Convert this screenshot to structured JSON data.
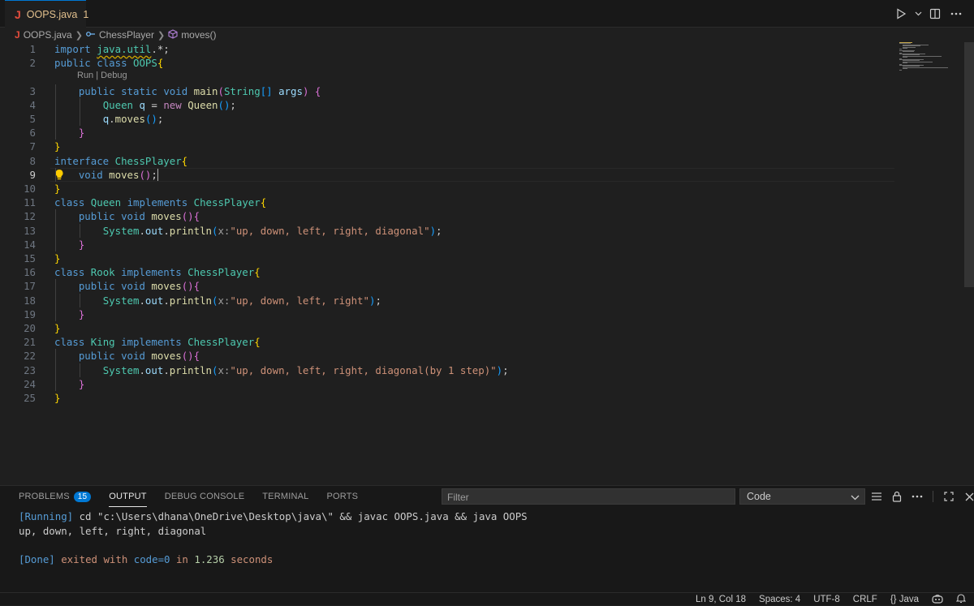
{
  "tab": {
    "icon": "java-icon",
    "name": "OOPS.java",
    "problems": "1",
    "close": "×"
  },
  "breadcrumb": {
    "file": "OOPS.java",
    "symbol1": "ChessPlayer",
    "symbol2": "moves()"
  },
  "editor": {
    "codelens": "Run | Debug",
    "line_numbers": [
      "1",
      "2",
      "3",
      "4",
      "5",
      "6",
      "7",
      "8",
      "9",
      "10",
      "11",
      "12",
      "13",
      "14",
      "15",
      "16",
      "17",
      "18",
      "19",
      "20",
      "21",
      "22",
      "23",
      "24",
      "25"
    ],
    "active_line": "9",
    "lines": [
      [
        [
          "kw",
          "import"
        ],
        [
          "pl",
          " "
        ],
        [
          "ty squig",
          "java.util"
        ],
        [
          "pl",
          ".*;"
        ]
      ],
      [
        [
          "kw",
          "public"
        ],
        [
          "pl",
          " "
        ],
        [
          "kw",
          "class"
        ],
        [
          "pl",
          " "
        ],
        [
          "ty",
          "OOPS"
        ],
        [
          "b1",
          "{"
        ]
      ],
      [
        [
          "pl",
          "    "
        ],
        [
          "kw",
          "public"
        ],
        [
          "pl",
          " "
        ],
        [
          "kw",
          "static"
        ],
        [
          "pl",
          " "
        ],
        [
          "kw",
          "void"
        ],
        [
          "pl",
          " "
        ],
        [
          "fn",
          "main"
        ],
        [
          "b2",
          "("
        ],
        [
          "ty",
          "String"
        ],
        [
          "b3",
          "[]"
        ],
        [
          "pl",
          " "
        ],
        [
          "va",
          "args"
        ],
        [
          "b2",
          ")"
        ],
        [
          "pl",
          " "
        ],
        [
          "b2",
          "{"
        ]
      ],
      [
        [
          "pl",
          "        "
        ],
        [
          "ty",
          "Queen"
        ],
        [
          "pl",
          " "
        ],
        [
          "va",
          "q"
        ],
        [
          "pl",
          " = "
        ],
        [
          "kw2",
          "new"
        ],
        [
          "pl",
          " "
        ],
        [
          "fn",
          "Queen"
        ],
        [
          "b3",
          "()"
        ],
        [
          "pl",
          ";"
        ]
      ],
      [
        [
          "pl",
          "        "
        ],
        [
          "va",
          "q"
        ],
        [
          "pl",
          "."
        ],
        [
          "fn",
          "moves"
        ],
        [
          "b3",
          "()"
        ],
        [
          "pl",
          ";"
        ]
      ],
      [
        [
          "pl",
          "    "
        ],
        [
          "b2",
          "}"
        ]
      ],
      [
        [
          "b1",
          "}"
        ]
      ],
      [
        [
          "kw",
          "interface"
        ],
        [
          "pl",
          " "
        ],
        [
          "ty",
          "ChessPlayer"
        ],
        [
          "b1",
          "{"
        ]
      ],
      [
        [
          "pl",
          "    "
        ],
        [
          "kw",
          "void"
        ],
        [
          "pl",
          " "
        ],
        [
          "fn",
          "moves"
        ],
        [
          "b2",
          "()"
        ],
        [
          "pl",
          ";"
        ]
      ],
      [
        [
          "b1",
          "}"
        ]
      ],
      [
        [
          "kw",
          "class"
        ],
        [
          "pl",
          " "
        ],
        [
          "ty",
          "Queen"
        ],
        [
          "pl",
          " "
        ],
        [
          "kw",
          "implements"
        ],
        [
          "pl",
          " "
        ],
        [
          "ty",
          "ChessPlayer"
        ],
        [
          "b1",
          "{"
        ]
      ],
      [
        [
          "pl",
          "    "
        ],
        [
          "kw",
          "public"
        ],
        [
          "pl",
          " "
        ],
        [
          "kw",
          "void"
        ],
        [
          "pl",
          " "
        ],
        [
          "fn",
          "moves"
        ],
        [
          "b2",
          "()"
        ],
        [
          "b2",
          "{"
        ]
      ],
      [
        [
          "pl",
          "        "
        ],
        [
          "ty",
          "System"
        ],
        [
          "pl",
          "."
        ],
        [
          "va",
          "out"
        ],
        [
          "pl",
          "."
        ],
        [
          "fn",
          "println"
        ],
        [
          "b3",
          "("
        ],
        [
          "pm",
          "x:"
        ],
        [
          "st",
          "\"up, down, left, right, diagonal\""
        ],
        [
          "b3",
          ")"
        ],
        [
          "pl",
          ";"
        ]
      ],
      [
        [
          "pl",
          "    "
        ],
        [
          "b2",
          "}"
        ]
      ],
      [
        [
          "b1",
          "}"
        ]
      ],
      [
        [
          "kw",
          "class"
        ],
        [
          "pl",
          " "
        ],
        [
          "ty",
          "Rook"
        ],
        [
          "pl",
          " "
        ],
        [
          "kw",
          "implements"
        ],
        [
          "pl",
          " "
        ],
        [
          "ty",
          "ChessPlayer"
        ],
        [
          "b1",
          "{"
        ]
      ],
      [
        [
          "pl",
          "    "
        ],
        [
          "kw",
          "public"
        ],
        [
          "pl",
          " "
        ],
        [
          "kw",
          "void"
        ],
        [
          "pl",
          " "
        ],
        [
          "fn",
          "moves"
        ],
        [
          "b2",
          "()"
        ],
        [
          "b2",
          "{"
        ]
      ],
      [
        [
          "pl",
          "        "
        ],
        [
          "ty",
          "System"
        ],
        [
          "pl",
          "."
        ],
        [
          "va",
          "out"
        ],
        [
          "pl",
          "."
        ],
        [
          "fn",
          "println"
        ],
        [
          "b3",
          "("
        ],
        [
          "pm",
          "x:"
        ],
        [
          "st",
          "\"up, down, left, right\""
        ],
        [
          "b3",
          ")"
        ],
        [
          "pl",
          ";"
        ]
      ],
      [
        [
          "pl",
          "    "
        ],
        [
          "b2",
          "}"
        ]
      ],
      [
        [
          "b1",
          "}"
        ]
      ],
      [
        [
          "kw",
          "class"
        ],
        [
          "pl",
          " "
        ],
        [
          "ty",
          "King"
        ],
        [
          "pl",
          " "
        ],
        [
          "kw",
          "implements"
        ],
        [
          "pl",
          " "
        ],
        [
          "ty",
          "ChessPlayer"
        ],
        [
          "b1",
          "{"
        ]
      ],
      [
        [
          "pl",
          "    "
        ],
        [
          "kw",
          "public"
        ],
        [
          "pl",
          " "
        ],
        [
          "kw",
          "void"
        ],
        [
          "pl",
          " "
        ],
        [
          "fn",
          "moves"
        ],
        [
          "b2",
          "()"
        ],
        [
          "b2",
          "{"
        ]
      ],
      [
        [
          "pl",
          "        "
        ],
        [
          "ty",
          "System"
        ],
        [
          "pl",
          "."
        ],
        [
          "va",
          "out"
        ],
        [
          "pl",
          "."
        ],
        [
          "fn",
          "println"
        ],
        [
          "b3",
          "("
        ],
        [
          "pm",
          "x:"
        ],
        [
          "st",
          "\"up, down, left, right, diagonal(by 1 step)\""
        ],
        [
          "b3",
          ")"
        ],
        [
          "pl",
          ";"
        ]
      ],
      [
        [
          "pl",
          "    "
        ],
        [
          "b2",
          "}"
        ]
      ],
      [
        [
          "b1",
          "}"
        ]
      ]
    ]
  },
  "panel": {
    "tabs": [
      {
        "label": "PROBLEMS",
        "badge": "15",
        "active": false
      },
      {
        "label": "OUTPUT",
        "active": true
      },
      {
        "label": "DEBUG CONSOLE",
        "active": false
      },
      {
        "label": "TERMINAL",
        "active": false
      },
      {
        "label": "PORTS",
        "active": false
      }
    ],
    "filter_placeholder": "Filter",
    "channel": "Code",
    "output": {
      "run_tag": "[Running]",
      "run_cmd": " cd \"c:\\Users\\dhana\\OneDrive\\Desktop\\java\\\" && javac OOPS.java && java OOPS",
      "result": "up, down, left, right, diagonal",
      "done_tag": "[Done]",
      "done_1": " exited with ",
      "done_code": "code=0",
      "done_2": " in ",
      "done_time": "1.236",
      "done_3": " seconds"
    }
  },
  "status": {
    "position": "Ln 9, Col 18",
    "spaces": "Spaces: 4",
    "encoding": "UTF-8",
    "eol": "CRLF",
    "language": "{} Java"
  },
  "colors": {
    "accent": "#0078d4",
    "java": "#e44c3c",
    "modified": "#e2c08d"
  }
}
